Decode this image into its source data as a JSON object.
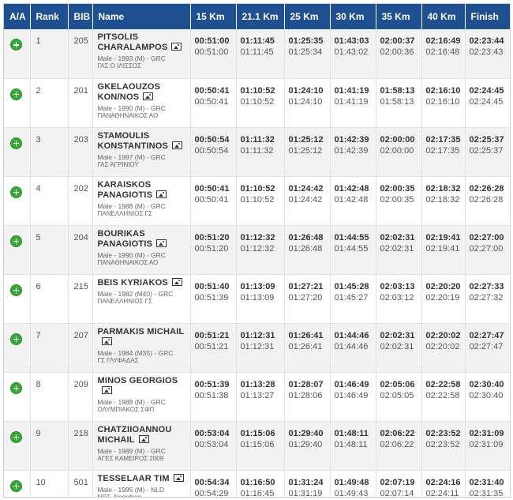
{
  "headers": [
    "A/A",
    "Rank",
    "BIB",
    "Name",
    "15 Km",
    "21.1 Km",
    "25 Km",
    "30 Km",
    "35 Km",
    "40 Km",
    "Finish"
  ],
  "rows": [
    {
      "rank": "1",
      "bib": "205",
      "name": "PITSOLIS CHARALAMPOS",
      "details": "Male - 1993 (M) - GRC",
      "club": "ΓΑΣ Ο ΙΛΙΣΣΟΣ",
      "splits": [
        [
          "00:51:00",
          "00:51:00"
        ],
        [
          "01:11:45",
          "01:11:45"
        ],
        [
          "01:25:35",
          "01:25:34"
        ],
        [
          "01:43:03",
          "01:43:02"
        ],
        [
          "02:00:37",
          "02:00:36"
        ],
        [
          "02:16:49",
          "02:16:48"
        ],
        [
          "02:23:44",
          "02:23:43"
        ]
      ]
    },
    {
      "rank": "2",
      "bib": "201",
      "name": "GKELAOUZOS KON/NOS",
      "details": "Male - 1990 (M) - GRC",
      "club": "ΠΑΝΑΘΗΝΑΙΚΟΣ ΑΟ",
      "splits": [
        [
          "00:50:41",
          "00:50:41"
        ],
        [
          "01:10:52",
          "01:10:52"
        ],
        [
          "01:24:10",
          "01:24:10"
        ],
        [
          "01:41:19",
          "01:41:19"
        ],
        [
          "01:58:13",
          "01:58:13"
        ],
        [
          "02:16:10",
          "02:16:10"
        ],
        [
          "02:24:45",
          "02:24:45"
        ]
      ]
    },
    {
      "rank": "3",
      "bib": "203",
      "name": "STAMOULIS KONSTANTINOS",
      "details": "Male - 1997 (M) - GRC",
      "club": "ΓΑΣ ΑΓΡΙΝΙΟΥ",
      "splits": [
        [
          "00:50:54",
          "00:50:54"
        ],
        [
          "01:11:32",
          "01:11:32"
        ],
        [
          "01:25:12",
          "01:25:12"
        ],
        [
          "01:42:39",
          "01:42:39"
        ],
        [
          "02:00:00",
          "02:00:00"
        ],
        [
          "02:17:35",
          "02:17:35"
        ],
        [
          "02:25:37",
          "02:25:37"
        ]
      ]
    },
    {
      "rank": "4",
      "bib": "202",
      "name": "KARAISKOS PANAGIOTIS",
      "details": "Male - 1988 (M) - GRC",
      "club": "ΠΑΝΕΛΛΗΝΙΟΣ ΓΣ",
      "splits": [
        [
          "00:50:41",
          "00:50:41"
        ],
        [
          "01:10:52",
          "01:10:52"
        ],
        [
          "01:24:42",
          "01:24:42"
        ],
        [
          "01:42:48",
          "01:42:48"
        ],
        [
          "02:00:35",
          "02:00:35"
        ],
        [
          "02:18:32",
          "02:18:32"
        ],
        [
          "02:26:28",
          "02:26:28"
        ]
      ]
    },
    {
      "rank": "5",
      "bib": "204",
      "name": "BOURIKAS PANAGIOTIS",
      "details": "Male - 1990 (M) - GRC",
      "club": "ΠΑΝΑΘΗΝΑΙΚΟΣ ΑΟ",
      "splits": [
        [
          "00:51:20",
          "00:51:20"
        ],
        [
          "01:12:32",
          "01:12:32"
        ],
        [
          "01:26:48",
          "01:26:48"
        ],
        [
          "01:44:55",
          "01:44:55"
        ],
        [
          "02:02:31",
          "02:02:31"
        ],
        [
          "02:19:41",
          "02:19:41"
        ],
        [
          "02:27:00",
          "02:27:00"
        ]
      ]
    },
    {
      "rank": "6",
      "bib": "215",
      "name": "BEIS KYRIAKOS",
      "details": "Male - 1982 (M40) - GRC",
      "club": "ΠΑΝΕΛΛΗΝΙΟΣ ΓΣ",
      "splits": [
        [
          "00:51:40",
          "00:51:39"
        ],
        [
          "01:13:09",
          "01:13:09"
        ],
        [
          "01:27:21",
          "01:27:20"
        ],
        [
          "01:45:28",
          "01:45:27"
        ],
        [
          "02:03:13",
          "02:03:12"
        ],
        [
          "02:20:20",
          "02:20:19"
        ],
        [
          "02:27:33",
          "02:27:32"
        ]
      ]
    },
    {
      "rank": "7",
      "bib": "207",
      "name": "PARMAKIS MICHAIL",
      "details": "Male - 1984 (M35) - GRC",
      "club": "ΓΣ ΓΛΥΦΑΔΑΣ",
      "splits": [
        [
          "00:51:21",
          "00:51:21"
        ],
        [
          "01:12:31",
          "01:12:31"
        ],
        [
          "01:26:41",
          "01:26:41"
        ],
        [
          "01:44:46",
          "01:44:46"
        ],
        [
          "02:02:31",
          "02:02:31"
        ],
        [
          "02:20:02",
          "02:20:02"
        ],
        [
          "02:27:47",
          "02:27:47"
        ]
      ]
    },
    {
      "rank": "8",
      "bib": "209",
      "name": "MINOS GEORGIOS",
      "details": "Male - 1988 (M) - GRC",
      "club": "ΟΛΥΜΠΙΑΚΟΣ ΣΦΠ",
      "splits": [
        [
          "00:51:39",
          "00:51:38"
        ],
        [
          "01:13:28",
          "01:13:27"
        ],
        [
          "01:28:07",
          "01:28:06"
        ],
        [
          "01:46:49",
          "01:46:49"
        ],
        [
          "02:05:06",
          "02:05:05"
        ],
        [
          "02:22:58",
          "02:22:58"
        ],
        [
          "02:30:40",
          "02:30:40"
        ]
      ]
    },
    {
      "rank": "9",
      "bib": "218",
      "name": "CHATZIIOANNOU MICHAIL",
      "details": "Male - 1989 (M) - GRC",
      "club": "ΑΓΕΣ ΚΑΜΕΙΡΟΣ 2009",
      "splits": [
        [
          "00:53:04",
          "00:53:04"
        ],
        [
          "01:15:06",
          "01:15:06"
        ],
        [
          "01:29:40",
          "01:29:40"
        ],
        [
          "01:48:11",
          "01:48:11"
        ],
        [
          "02:06:22",
          "02:06:22"
        ],
        [
          "02:23:52",
          "02:23:52"
        ],
        [
          "02:31:09",
          "02:31:09"
        ]
      ]
    },
    {
      "rank": "10",
      "bib": "501",
      "name": "TESSELAAR TIM",
      "details": "Male - 1995 (M) - NLD",
      "club": "NRT- Noordkop",
      "splits": [
        [
          "00:54:34",
          "00:54:29"
        ],
        [
          "01:16:50",
          "01:16:45"
        ],
        [
          "01:31:24",
          "01:31:19"
        ],
        [
          "01:49:48",
          "01:49:43"
        ],
        [
          "02:07:19",
          "02:07:14"
        ],
        [
          "02:24:16",
          "02:24:11"
        ],
        [
          "02:31:40",
          "02:31:35"
        ]
      ]
    }
  ]
}
